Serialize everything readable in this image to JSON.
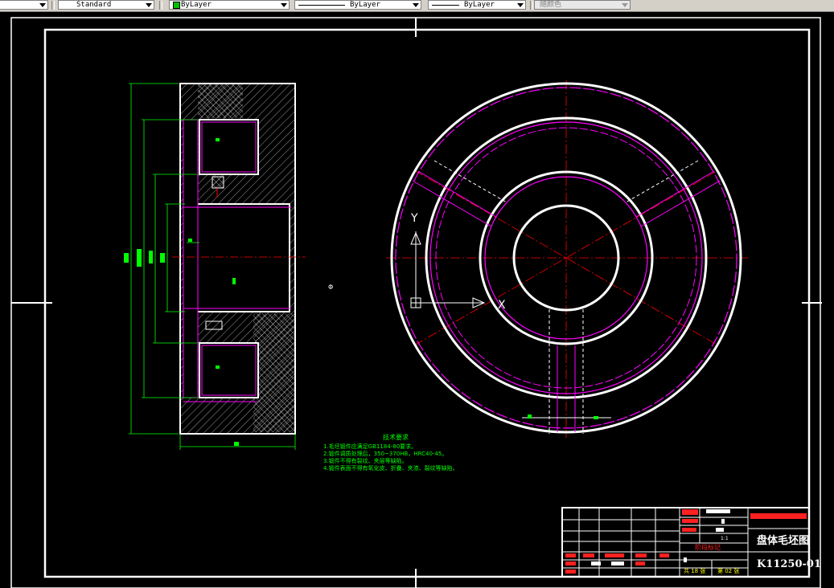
{
  "toolbar": {
    "text_style": "Standard",
    "layer_color": "ByLayer",
    "linetype": "ByLayer",
    "lineweight": "ByLayer",
    "plot_style": "随颜色"
  },
  "colors": {
    "background": "#000000",
    "outline": "#ffffff",
    "hidden": "#ff00ff",
    "dimension": "#00ff00",
    "center": "#ff0000"
  },
  "drawing": {
    "phi_note": "Φ",
    "ucs": {
      "y": "Y",
      "x": "X"
    }
  },
  "tech_requirements": {
    "title": "技术要求",
    "items": [
      "1.毛坯锻件应满足GB1184-80要求。",
      "2.锻件调质处理后，350~370HB，HRC40-45。",
      "3.锻件不得有裂纹、夹层等缺陷。",
      "4.锻件表面不得有氧化皮、折叠、夹渣、裂纹等缺陷。"
    ]
  },
  "title_block": {
    "name": "盘体毛坯图",
    "code": "K11250-01",
    "scale": "1:1",
    "stage_label": "阶段标记",
    "sheet_total": "共 18 张",
    "sheet_no": "第 02 张"
  }
}
